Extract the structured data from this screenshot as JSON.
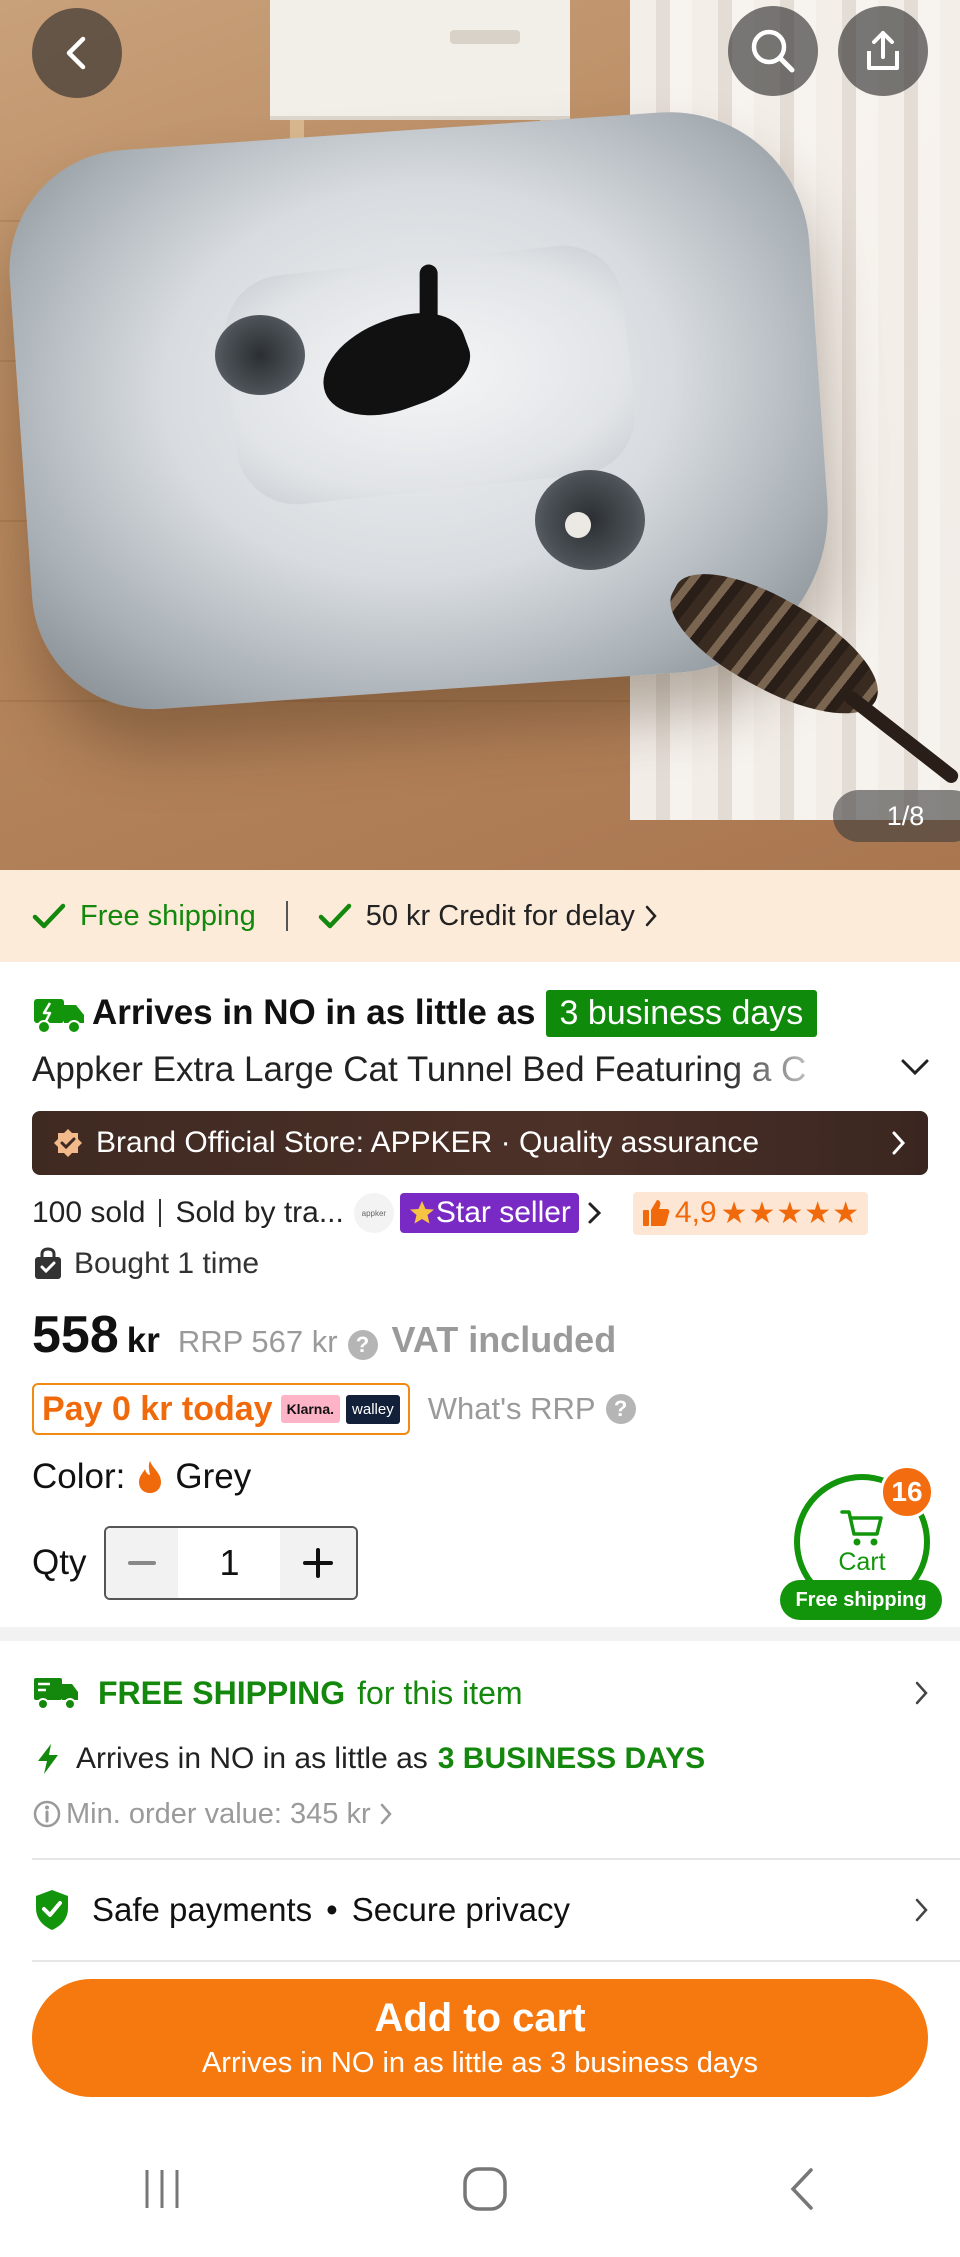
{
  "hero": {
    "image_counter": "1/8",
    "back_icon": "chevron-left-icon",
    "search_icon": "search-icon",
    "share_icon": "share-icon"
  },
  "shipping_strip": {
    "free_shipping": "Free shipping",
    "credit": "50 kr Credit for delay",
    "color_green": "#13880c",
    "background": "#fcebd9"
  },
  "arrival": {
    "prefix": "Arrives in NO in as little as",
    "badge": "3 business days"
  },
  "product": {
    "title": "Appker Extra Large Cat Tunnel Bed Featuring a C"
  },
  "brand_bar": {
    "text": "Brand Official Store: APPKER · Quality assurance"
  },
  "meta": {
    "sold": "100 sold",
    "sold_by": "Sold by tra...",
    "mini_logo": "appker",
    "star_seller": "Star seller",
    "rating": "4,9",
    "stars": "★★★★★",
    "bought": "Bought 1 time"
  },
  "price": {
    "amount": "558",
    "currency": "kr",
    "rrp": "RRP 567 kr",
    "vat": "VAT included"
  },
  "pay": {
    "text": "Pay 0 kr today",
    "klarna": "Klarna.",
    "walley": "walley",
    "whats_rrp": "What's RRP"
  },
  "color": {
    "label": "Color:",
    "value": "Grey"
  },
  "qty": {
    "label": "Qty",
    "value": "1"
  },
  "cart": {
    "count": "16",
    "label": "Cart",
    "free_shipping": "Free shipping",
    "accent": "#13950b"
  },
  "shipping_info": {
    "free_title": "FREE SHIPPING",
    "free_suffix": "for this item",
    "arrives_prefix": "Arrives in NO in as little as",
    "arrives_days": "3 BUSINESS DAYS",
    "min_order": "Min. order value: 345 kr"
  },
  "safety": {
    "safe_payments": "Safe payments",
    "dot": "•",
    "secure_privacy": "Secure privacy"
  },
  "add_to_cart": {
    "label": "Add to cart",
    "sub": "Arrives in NO in as little as 3 business days",
    "color": "#f6790f"
  },
  "system_nav": {
    "recents": "recents-icon",
    "home": "home-icon",
    "back": "back-icon"
  }
}
